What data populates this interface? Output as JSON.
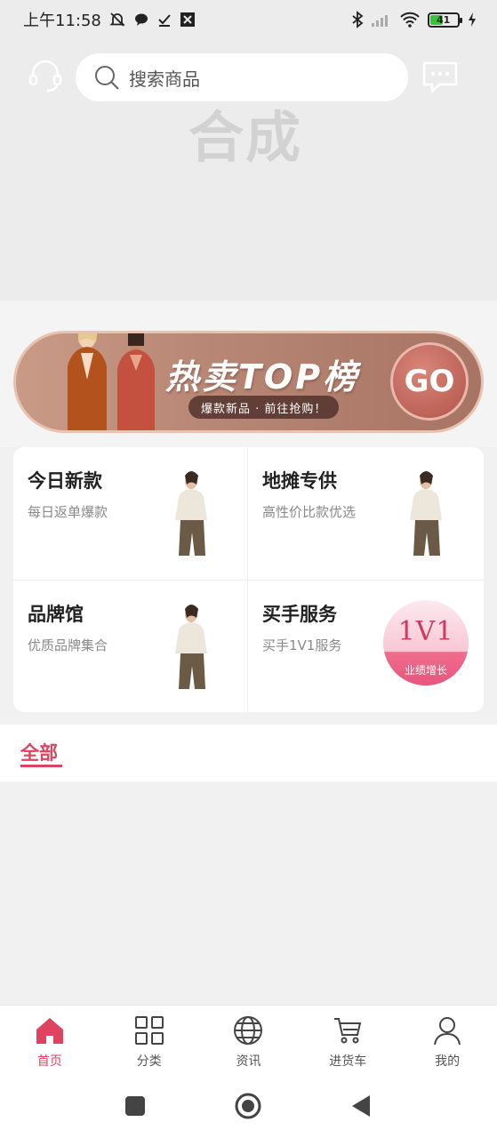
{
  "status_bar": {
    "time": "上午11:58",
    "battery": "41"
  },
  "header": {
    "search_placeholder": "搜索商品",
    "watermark": "合成"
  },
  "banner": {
    "title": "热卖TOP榜",
    "subtitle": "爆款新品 · 前往抢购！",
    "go_label": "GO"
  },
  "features": [
    {
      "title": "今日新款",
      "subtitle": "每日返单爆款"
    },
    {
      "title": "地摊专供",
      "subtitle": "高性价比款优选"
    },
    {
      "title": "品牌馆",
      "subtitle": "优质品牌集合"
    },
    {
      "title": "买手服务",
      "subtitle": "买手1V1服务",
      "badge_big": "1V1",
      "badge_small": "业绩增长"
    }
  ],
  "tabs": {
    "all": "全部"
  },
  "bottom_nav": [
    {
      "label": "首页",
      "icon": "home-icon",
      "active": true
    },
    {
      "label": "分类",
      "icon": "grid-icon"
    },
    {
      "label": "资讯",
      "icon": "globe-icon"
    },
    {
      "label": "进货车",
      "icon": "cart-icon"
    },
    {
      "label": "我的",
      "icon": "user-icon"
    }
  ],
  "colors": {
    "accent": "#e0435f",
    "banner": "#b88775"
  }
}
